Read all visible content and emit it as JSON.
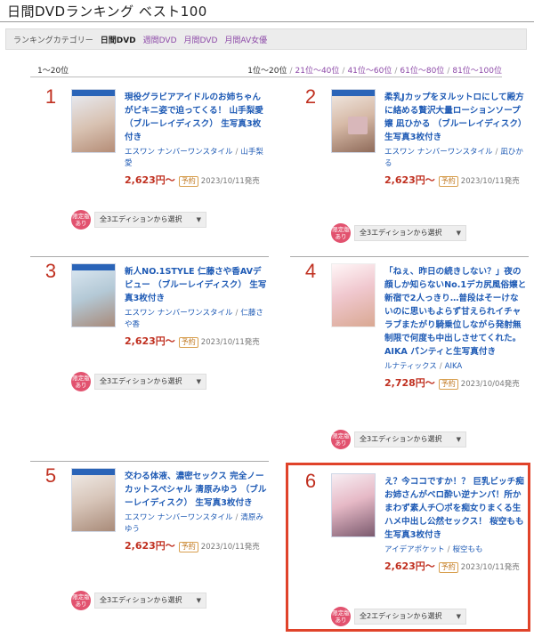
{
  "page": {
    "title": "日間DVDランキング ベスト100"
  },
  "category_bar": {
    "label": "ランキングカテゴリー",
    "items": [
      {
        "label": "日間DVD",
        "active": true
      },
      {
        "label": "週間DVD",
        "active": false
      },
      {
        "label": "月間DVD",
        "active": false
      },
      {
        "label": "月間AV女優",
        "active": false
      }
    ]
  },
  "range_bar": {
    "current": "1〜20位",
    "links": [
      "1位〜20位",
      "21位〜40位",
      "41位〜60位",
      "61位〜80位",
      "81位〜100位"
    ],
    "separator": "/"
  },
  "common": {
    "reserve_badge": "予約",
    "limited_badge": "限定版あり",
    "slash": "/"
  },
  "items": [
    {
      "rank": "1",
      "title": "現役グラビアアイドルのお姉ちゃんがビキニ姿で迫ってくる！ 山手梨愛 （ブルーレイディスク） 生写真3枚付き",
      "maker": "エスワン ナンバーワンスタイル",
      "actress": "山手梨愛",
      "price": "2,623円〜",
      "release": "2023/10/11発売",
      "edition": "全3エディションから選択"
    },
    {
      "rank": "2",
      "title": "柔乳Jカップをヌルットロにして殿方に絡める贅沢大量ローションソープ嬢 凪ひかる （ブルーレイディスク） 生写真3枚付き",
      "maker": "エスワン ナンバーワンスタイル",
      "actress": "凪ひかる",
      "price": "2,623円〜",
      "release": "2023/10/11発売",
      "edition": "全3エディションから選択"
    },
    {
      "rank": "3",
      "title": "新人NO.1STYLE 仁藤さや香AVデビュー （ブルーレイディスク） 生写真3枚付き",
      "maker": "エスワン ナンバーワンスタイル",
      "actress": "仁藤さや香",
      "price": "2,623円〜",
      "release": "2023/10/11発売",
      "edition": "全3エディションから選択"
    },
    {
      "rank": "4",
      "title": "「ねぇ、昨日の続きしない？」夜の顔しか知らないNo.1デカ尻風俗嬢と新宿で2人っきり…普段はそーけないのに思いもよらず甘えられイチャラブまたがり騎乗位しながら発射無制限で何度も中出しさせてくれた。 AIKA パンティと生写真付き",
      "maker": "ルナティックス",
      "actress": "AIKA",
      "price": "2,728円〜",
      "release": "2023/10/04発売",
      "edition": "全3エディションから選択"
    },
    {
      "rank": "5",
      "title": "交わる体液、濃密セックス 完全ノーカットスペシャル 清原みゆう （ブルーレイディスク） 生写真3枚付き",
      "maker": "エスワン ナンバーワンスタイル",
      "actress": "清原みゆう",
      "price": "2,623円〜",
      "release": "2023/10/11発売",
      "edition": "全3エディションから選択"
    },
    {
      "rank": "6",
      "title": "え？今ココですか！？ 巨乳ビッチ痴お姉さんがベロ酔い逆ナンパ！所かまわず素人チ〇ポを痴女りまくる生ハメ中出し公然セックス！ 桜空もも 生写真3枚付き",
      "maker": "アイデアポケット",
      "actress": "桜空もも",
      "price": "2,623円〜",
      "release": "2023/10/11発売",
      "edition": "全2エディションから選択"
    }
  ],
  "colors": {
    "rank": "#c03020",
    "link": "#1f5bb5",
    "category_link": "#8d4aa8",
    "highlight": "#e0432a",
    "limited": "#e2526f"
  }
}
